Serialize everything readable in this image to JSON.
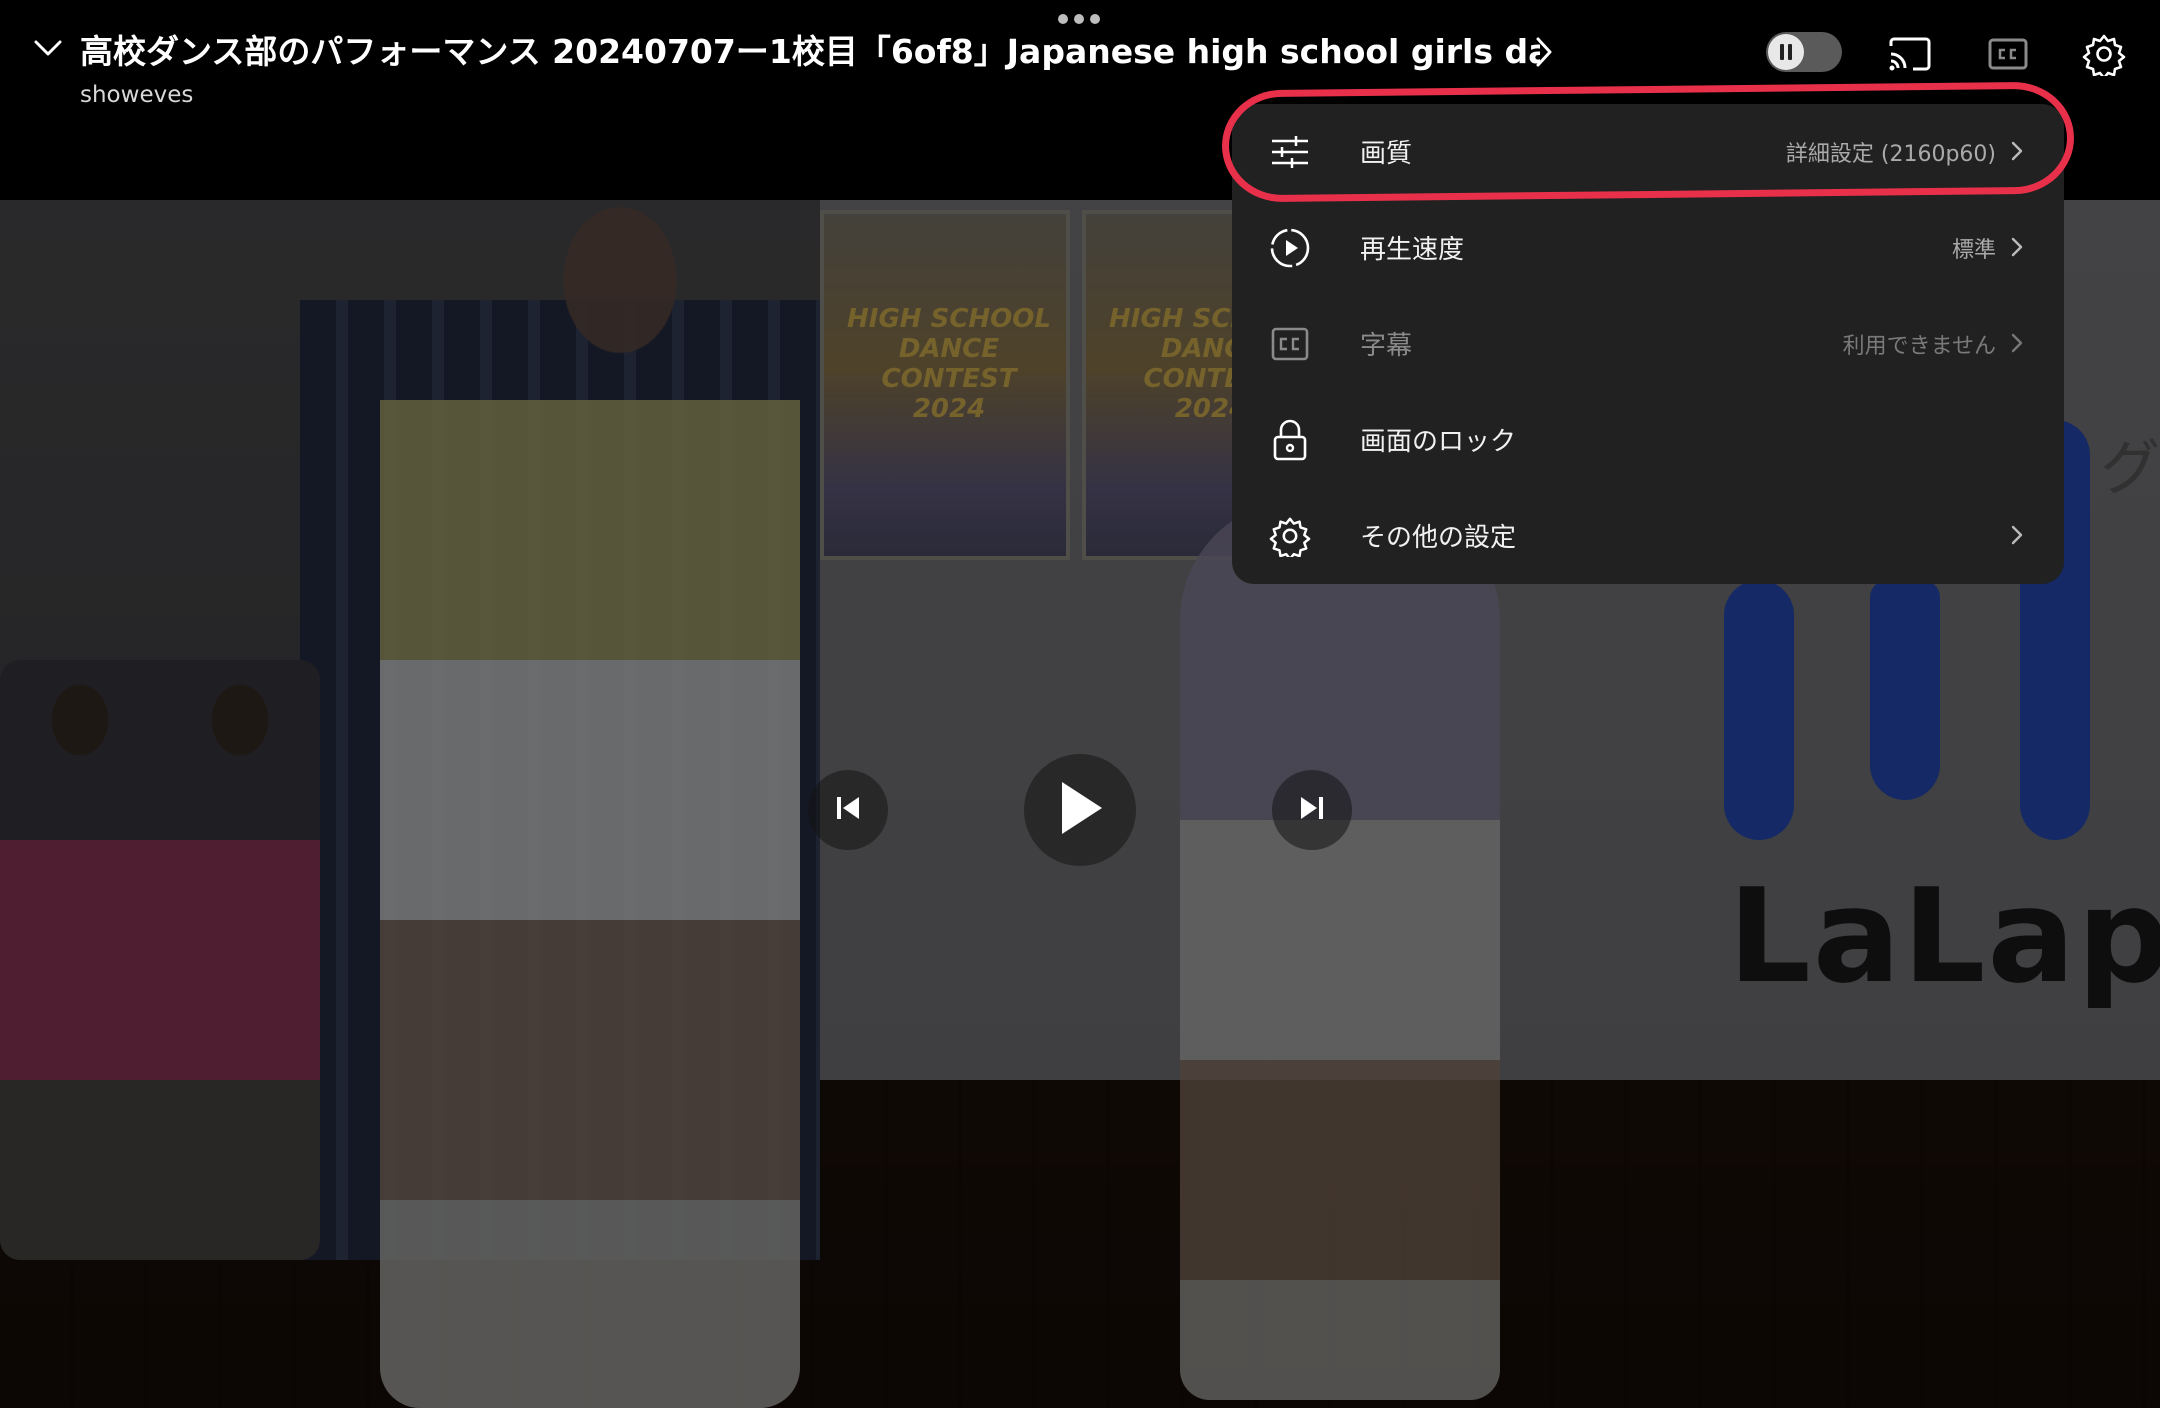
{
  "header": {
    "title": "高校ダンス部のパフォーマンス 20240707ー1校目「6of8」Japanese high school girls dance",
    "channel": "showeves"
  },
  "icons": {
    "collapse": "chevron-down-icon",
    "title_more": "chevron-right-icon",
    "autoplay": "autoplay-pause-toggle",
    "cast": "cast-icon",
    "captions": "cc-icon",
    "settings": "gear-icon"
  },
  "settings_menu": {
    "items": [
      {
        "label": "画質",
        "value": "詳細設定 (2160p60)",
        "icon": "sliders-icon",
        "enabled": true,
        "highlighted": true
      },
      {
        "label": "再生速度",
        "value": "標準",
        "icon": "playback-speed-icon",
        "enabled": true
      },
      {
        "label": "字幕",
        "value": "利用できません",
        "icon": "cc-icon",
        "enabled": false
      },
      {
        "label": "画面のロック",
        "value": "",
        "icon": "lock-icon",
        "enabled": true
      },
      {
        "label": "その他の設定",
        "value": "",
        "icon": "gear-icon",
        "enabled": true
      }
    ]
  },
  "video": {
    "poster_text": "HIGH SCHOOL DANCE CONTEST 2024",
    "brand": "LaLapo",
    "brand_side": "グパ"
  },
  "controls": {
    "previous": "skip-previous-icon",
    "play": "play-icon",
    "next": "skip-next-icon"
  },
  "colors": {
    "annotation": "#e8304a",
    "menu_bg": "#212121"
  }
}
